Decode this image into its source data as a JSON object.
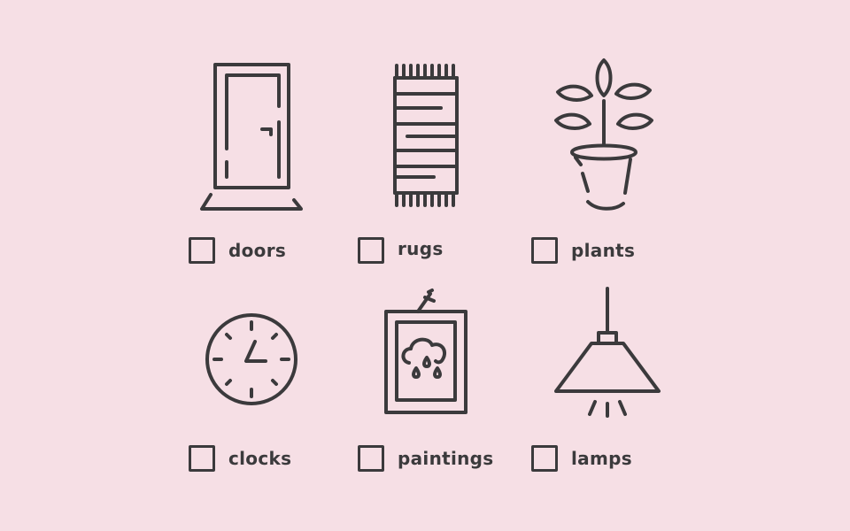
{
  "background_color": "#f6dfe5",
  "ink_color": "#3b3a3c",
  "items": [
    {
      "label": "doors",
      "icon": "door-icon",
      "checked": false
    },
    {
      "label": "rugs",
      "icon": "rug-icon",
      "checked": false
    },
    {
      "label": "plants",
      "icon": "plant-icon",
      "checked": false
    },
    {
      "label": "clocks",
      "icon": "clock-icon",
      "checked": false
    },
    {
      "label": "paintings",
      "icon": "painting-icon",
      "checked": false
    },
    {
      "label": "lamps",
      "icon": "lamp-icon",
      "checked": false
    }
  ]
}
